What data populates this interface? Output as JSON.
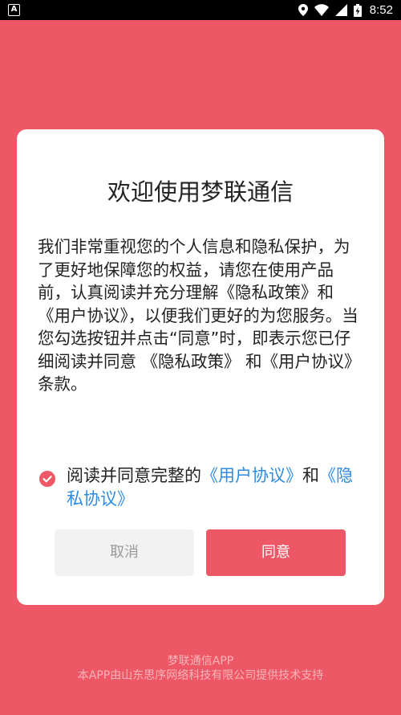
{
  "status_bar": {
    "left_icon": "A",
    "icons": [
      "location-icon",
      "wifi-icon",
      "signal-icon",
      "battery-icon"
    ],
    "time": "8:52"
  },
  "dialog": {
    "title": "欢迎使用梦联通信",
    "body": "我们非常重视您的个人信息和隐私保护，为了更好地保障您的权益，请您在使用产品前，认真阅读并充分理解《隐私政策》和《用户协议》，以便我们更好的为您服务。当您勾选按钮并点击“同意”时，即表示您已仔细阅读并同意 《隐私政策》 和《用户协议》 条款。",
    "agree": {
      "prefix": "阅读并同意完整的",
      "user_agreement_link": "《用户协议》",
      "conjunction": "和",
      "privacy_link": "《隐私协议》",
      "checked": true
    },
    "cancel_label": "取消",
    "agree_label": "同意"
  },
  "footer": {
    "app_name": "梦联通信APP",
    "support_text": "本APP由山东思序网络科技有限公司提供技术支持"
  },
  "colors": {
    "background": "#EE5765",
    "link": "#2E8BE0",
    "cancel_bg": "#F2F2F2"
  }
}
